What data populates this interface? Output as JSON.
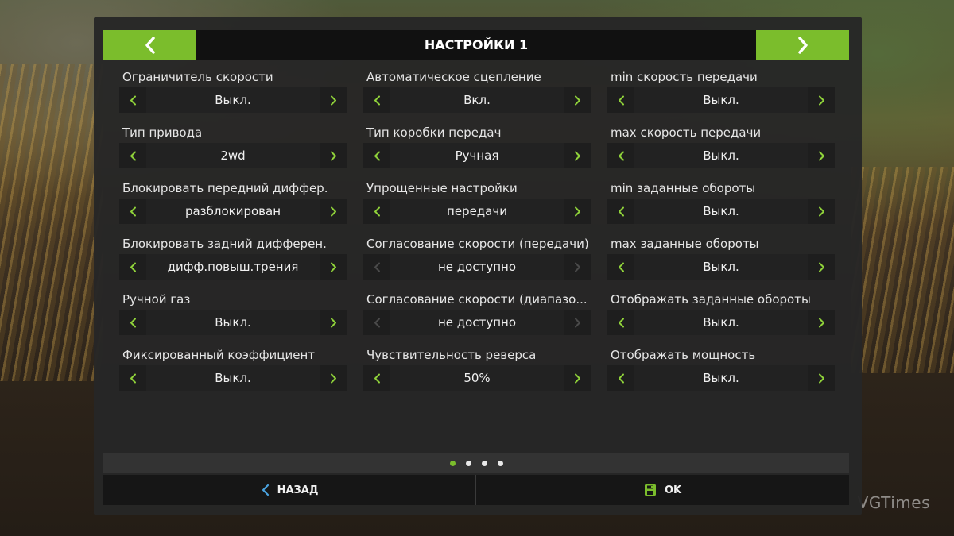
{
  "header": {
    "title": "НАСТРОЙКИ 1"
  },
  "columns": [
    [
      {
        "label": "Ограничитель скорости",
        "value": "Выкл.",
        "enabled": true
      },
      {
        "label": "Тип привода",
        "value": "2wd",
        "enabled": true
      },
      {
        "label": "Блокировать передний диффер.",
        "value": "разблокирован",
        "enabled": true
      },
      {
        "label": "Блокировать задний дифферен.",
        "value": "дифф.повыш.трения",
        "enabled": true
      },
      {
        "label": "Ручной газ",
        "value": "Выкл.",
        "enabled": true
      },
      {
        "label": "Фиксированный коэффициент",
        "value": "Выкл.",
        "enabled": true
      }
    ],
    [
      {
        "label": "Автоматическое сцепление",
        "value": "Вкл.",
        "enabled": true
      },
      {
        "label": "Тип коробки передач",
        "value": "Ручная",
        "enabled": true
      },
      {
        "label": "Упрощенные настройки",
        "value": "передачи",
        "enabled": true
      },
      {
        "label": "Согласование скорости (передачи)",
        "value": "не доступно",
        "enabled": false
      },
      {
        "label": "Согласование скорости (диапазо...",
        "value": "не доступно",
        "enabled": false
      },
      {
        "label": "Чувствительность реверса",
        "value": "50%",
        "enabled": true
      }
    ],
    [
      {
        "label": "min скорость передачи",
        "value": "Выкл.",
        "enabled": true
      },
      {
        "label": "max скорость передачи",
        "value": "Выкл.",
        "enabled": true
      },
      {
        "label": "min заданные обороты",
        "value": "Выкл.",
        "enabled": true
      },
      {
        "label": "max заданные обороты",
        "value": "Выкл.",
        "enabled": true
      },
      {
        "label": "Отображать заданные обороты",
        "value": "Выкл.",
        "enabled": true
      },
      {
        "label": "Отображать мощность",
        "value": "Выкл.",
        "enabled": true
      }
    ]
  ],
  "pager": {
    "pages": 4,
    "active": 0
  },
  "footer": {
    "back_label": "НАЗАД",
    "ok_label": "OK"
  },
  "watermark": "VGTimes",
  "colors": {
    "accent": "#7bbd2c",
    "arrow_enabled": "#8fd13a",
    "arrow_disabled": "#4a4a4a",
    "back_icon": "#4aa3e0"
  },
  "icons": {
    "prev": "chevron-left-icon",
    "next": "chevron-right-icon",
    "back": "back-arrow-icon",
    "ok": "save-floppy-icon"
  }
}
